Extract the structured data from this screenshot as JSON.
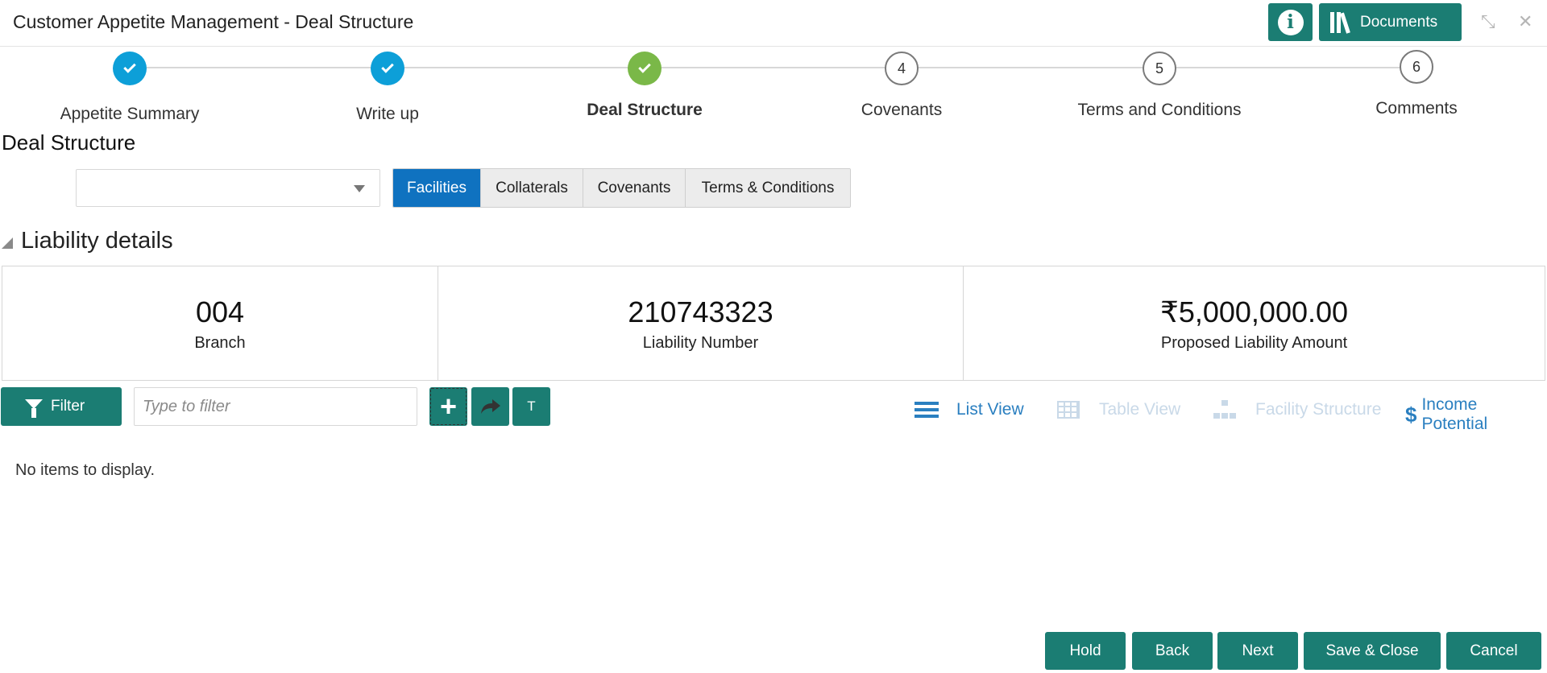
{
  "header": {
    "title": "Customer Appetite Management - Deal Structure",
    "documents_label": "Documents",
    "info_icon": "info-icon",
    "collapse_icon": "collapse-icon",
    "close_icon": "close-icon"
  },
  "stepper": {
    "steps": [
      {
        "label": "Appetite Summary",
        "number": "",
        "state": "done"
      },
      {
        "label": "Write up",
        "number": "",
        "state": "done"
      },
      {
        "label": "Deal Structure",
        "number": "",
        "state": "current"
      },
      {
        "label": "Covenants",
        "number": "4",
        "state": "todo"
      },
      {
        "label": "Terms and Conditions",
        "number": "5",
        "state": "todo"
      },
      {
        "label": "Comments",
        "number": "6",
        "state": "todo"
      }
    ]
  },
  "page": {
    "title": "Deal Structure",
    "select_value": ""
  },
  "tabs": [
    {
      "label": "Facilities",
      "active": true
    },
    {
      "label": "Collaterals",
      "active": false
    },
    {
      "label": "Covenants",
      "active": false
    },
    {
      "label": "Terms & Conditions",
      "active": false
    }
  ],
  "liability": {
    "section_title": "Liability details",
    "cards": [
      {
        "value": "004",
        "label": "Branch"
      },
      {
        "value": "210743323",
        "label": "Liability Number"
      },
      {
        "value": "₹5,000,000.00",
        "label": "Proposed Liability Amount"
      }
    ]
  },
  "toolbar": {
    "filter_label": "Filter",
    "filter_placeholder": "Type to filter",
    "filter_value": "",
    "t_button_label": "T",
    "views": {
      "list": "List View",
      "table": "Table View",
      "facility": "Facility Structure",
      "income": "Income Potential"
    }
  },
  "list": {
    "empty_message": "No items to display."
  },
  "footer": {
    "hold": "Hold",
    "back": "Back",
    "next": "Next",
    "save_close": "Save & Close",
    "cancel": "Cancel"
  },
  "colors": {
    "primary_teal": "#1b7d73",
    "step_done": "#0d9fd8",
    "step_current": "#7ab848",
    "tab_active": "#0f72c0",
    "link_blue": "#2a7fc0"
  }
}
